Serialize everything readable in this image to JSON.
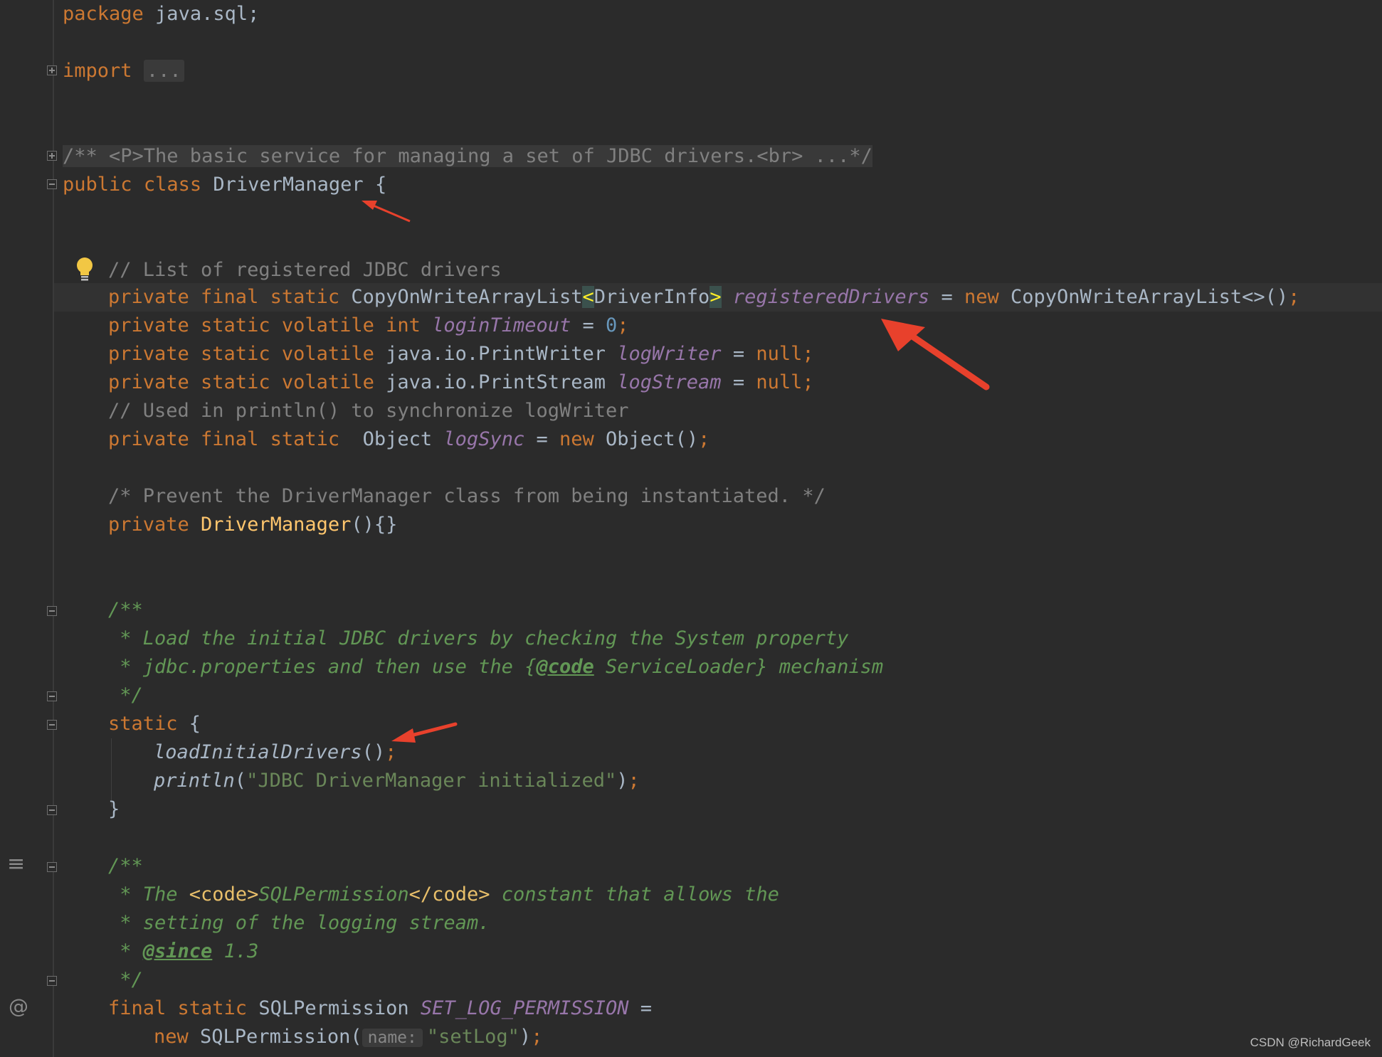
{
  "editor": {
    "theme_colors": {
      "background": "#2b2b2b",
      "keyword": "#cc7832",
      "field": "#9876aa",
      "number": "#6897bb",
      "string": "#6a8759",
      "comment": "#808080",
      "doc_comment": "#629755",
      "method_decl": "#ffc66d",
      "annotation_arrow": "#e8412c"
    },
    "lines": {
      "l1": {
        "kw": "package",
        "rest": " java.sql;"
      },
      "l2": {
        "kw": "import",
        "fold": "..."
      },
      "l3": {
        "doc": "/** <P>The basic service for managing a set of JDBC drivers.<br> ...*/"
      },
      "l4": {
        "kw1": "public",
        "kw2": "class",
        "name": "DriverManager",
        "brace": " {"
      },
      "l5": {
        "comment": "// List of registered JDBC drivers"
      },
      "l6": {
        "kw": "private final static ",
        "type": "CopyOnWriteArrayList",
        "lt": "<",
        "generic": "DriverInfo",
        "gt": ">",
        "field": "registeredDrivers",
        "eq": " = ",
        "new": "new",
        "ctor": " CopyOnWriteArrayList<>()",
        "semi": ";"
      },
      "l7": {
        "kw": "private static volatile int ",
        "field": "loginTimeout",
        "eq": " = ",
        "num": "0",
        "semi": ";"
      },
      "l8": {
        "kw": "private static volatile ",
        "type": "java.io.PrintWriter ",
        "field": "logWriter",
        "eq": " = ",
        "null": "null",
        "semi": ";"
      },
      "l9": {
        "kw": "private static volatile ",
        "type": "java.io.PrintStream ",
        "field": "logStream",
        "eq": " = ",
        "null": "null",
        "semi": ";"
      },
      "l10": {
        "comment": "// Used in println() to synchronize logWriter"
      },
      "l11": {
        "kw": "private final static  ",
        "type": "Object ",
        "field": "logSync",
        "eq": " = ",
        "new": "new",
        "ctor": " Object()",
        "semi": ";"
      },
      "l12": {
        "comment": "/* Prevent the DriverManager class from being instantiated. */"
      },
      "l13": {
        "kw": "private ",
        "name": "DriverManager",
        "rest": "(){}"
      },
      "l14": {
        "doc": "/**"
      },
      "l15": {
        "doc": " * Load the initial JDBC drivers by checking the System property"
      },
      "l16": {
        "doc1": " * jdbc.properties and then use the {",
        "tag": "@code",
        "doc2": " ServiceLoader} mechanism"
      },
      "l17": {
        "doc": " */"
      },
      "l18": {
        "kw": "static",
        "brace": " {"
      },
      "l19": {
        "call": "loadInitialDrivers",
        "rest": "()",
        "semi": ";"
      },
      "l20": {
        "call": "println",
        "open": "(",
        "str": "\"JDBC DriverManager initialized\"",
        "close": ")",
        "semi": ";"
      },
      "l21": {
        "brace": "}"
      },
      "l22": {
        "doc": "/**"
      },
      "l23": {
        "doc1": " * The ",
        "m1": "<code>",
        "doc2": "SQLPermission",
        "m2": "</code>",
        "doc3": " constant that allows the"
      },
      "l24": {
        "doc": " * setting of the logging stream."
      },
      "l25": {
        "doc1": " * ",
        "tag": "@since",
        "doc2": " 1.3"
      },
      "l26": {
        "doc": " */"
      },
      "l27": {
        "kw": "final static ",
        "type": "SQLPermission ",
        "field": "SET_LOG_PERMISSION",
        "eq": " ="
      },
      "l28": {
        "new": "new",
        "ctor": " SQLPermission(",
        "hint": "name:",
        "str": "\"setLog\"",
        "close": ")",
        "semi": ";"
      }
    }
  },
  "gutter": {
    "at_icon": "@",
    "structure_icon": "structure-icon",
    "bulb_icon": "lightbulb-icon"
  },
  "watermark": "CSDN @RichardGeek"
}
